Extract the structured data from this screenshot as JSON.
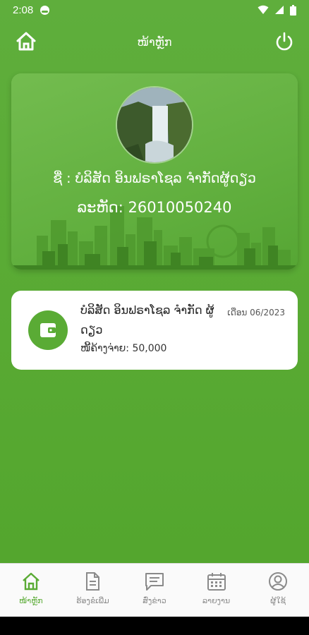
{
  "status_bar": {
    "time": "2:08"
  },
  "header": {
    "title": "ໜ້າຫຼັກ"
  },
  "profile": {
    "name": "ຊື່ : ບໍລິສັດ ອິນຟຣາໂຊລ ຈຳກັດຜູ້ດຽວ",
    "code": "ລະຫັດ: 26010050240"
  },
  "bill": {
    "name": "ບໍລິສັດ ອິນຟຣາໂຊລ ຈຳກັດ ຜູ້ດຽວ",
    "month": "ເດືອນ 06/2023",
    "amount": "ໜີ້ຄ້າງຈ່າຍ: 50,000"
  },
  "nav": [
    {
      "label": "ໜ້າຫຼັກ",
      "icon": "home-icon",
      "active": true
    },
    {
      "label": "ຮ້ອງຂໍເພີ່ມ",
      "icon": "document-icon",
      "active": false
    },
    {
      "label": "ສົ່ງຂ່າວ",
      "icon": "chat-icon",
      "active": false
    },
    {
      "label": "ລາຍງານ",
      "icon": "calendar-icon",
      "active": false
    },
    {
      "label": "ຜູ້ໃຊ້",
      "icon": "user-icon",
      "active": false
    }
  ],
  "colors": {
    "primary": "#5aab35",
    "card": "#ffffff"
  }
}
